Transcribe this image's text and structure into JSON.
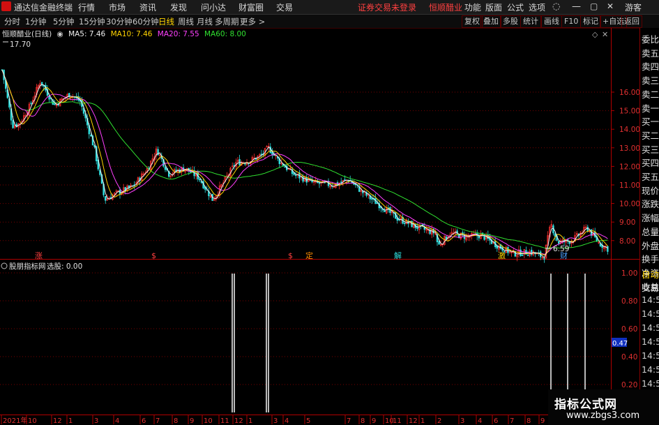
{
  "titlebar": {
    "app_name": "通达信金融终端",
    "menus": [
      "行情",
      "市场",
      "资讯",
      "发现",
      "问小达",
      "财富圈",
      "交易"
    ],
    "notice": "证券交易未登录",
    "stock_name": "恒顺醋业",
    "right_items": [
      "功能",
      "版面",
      "公式",
      "选项"
    ],
    "guest": "游客"
  },
  "periods": [
    "分时",
    "1分钟",
    "5分钟",
    "15分钟",
    "30分钟",
    "60分钟",
    "日线",
    "周线",
    "月线",
    "多周期",
    "更多 >"
  ],
  "active_period": "日线",
  "toolbar": [
    "复权",
    "叠加",
    "多股",
    "统计",
    "画线",
    "F10",
    "标记",
    "+自选",
    "返回"
  ],
  "info": {
    "stock": "恒顺醋业(日线)",
    "ma5": "MA5: 7.46",
    "ma10": "MA10: 7.46",
    "ma20": "MA20: 7.55",
    "ma60": "MA60: 8.00",
    "high_label": "17.70",
    "low_label": "6.59"
  },
  "colors": {
    "ma5": "#f0f0f0",
    "ma10": "#ffd400",
    "ma20": "#ff40ff",
    "ma60": "#30e030",
    "up": "#ff3030",
    "down": "#30e0e0",
    "grid": "#7a0000",
    "axis": "#b00000"
  },
  "price_axis": [
    "16.00",
    "15.00",
    "14.00",
    "13.00",
    "12.00",
    "11.00",
    "10.00",
    "9.00",
    "8.00"
  ],
  "events": [
    {
      "label": "涨",
      "color": "#ff4040"
    },
    {
      "label": "$",
      "color": "#ff4040"
    },
    {
      "label": "$",
      "color": "#ff4040"
    },
    {
      "label": "定",
      "color": "#ff8c00"
    },
    {
      "label": "解",
      "color": "#30e0e0"
    },
    {
      "label": "激",
      "color": "#ffd400"
    },
    {
      "label": "财",
      "color": "#4aa0ff"
    }
  ],
  "indicator": {
    "title": "股朋指标网",
    "value_label": "选股: 0.00",
    "axis": [
      "1.00",
      "0.80",
      "0.60",
      "0.40",
      "0.20"
    ],
    "cursor_value": "0.47"
  },
  "date_axis": [
    "2021年",
    "10",
    "12",
    "1",
    "3",
    "4",
    "6",
    "7",
    "8",
    "9",
    "10",
    "11",
    "12",
    "1",
    "3",
    "4",
    "5",
    "7",
    "8",
    "9",
    "10",
    "11",
    "12",
    "1",
    "2",
    "3",
    "4",
    "6",
    "7",
    "8",
    "9"
  ],
  "right_panel": {
    "top": [
      "委比",
      "卖五",
      "卖四",
      "卖三",
      "卖二",
      "卖一",
      "买一",
      "买二",
      "买三",
      "买四",
      "买五",
      "现价",
      "涨跌",
      "涨幅",
      "总量",
      "外盘",
      "换手",
      "净资",
      "收益"
    ],
    "bottom_tabs": [
      "自动",
      "交易"
    ],
    "times": [
      "14:56",
      "14:56",
      "14:56",
      "14:56",
      "14:56",
      "14:56",
      "14:56",
      "14:56"
    ]
  },
  "watermark": {
    "line1": "指标公式网",
    "line2": "www.zbgs3.com"
  }
}
